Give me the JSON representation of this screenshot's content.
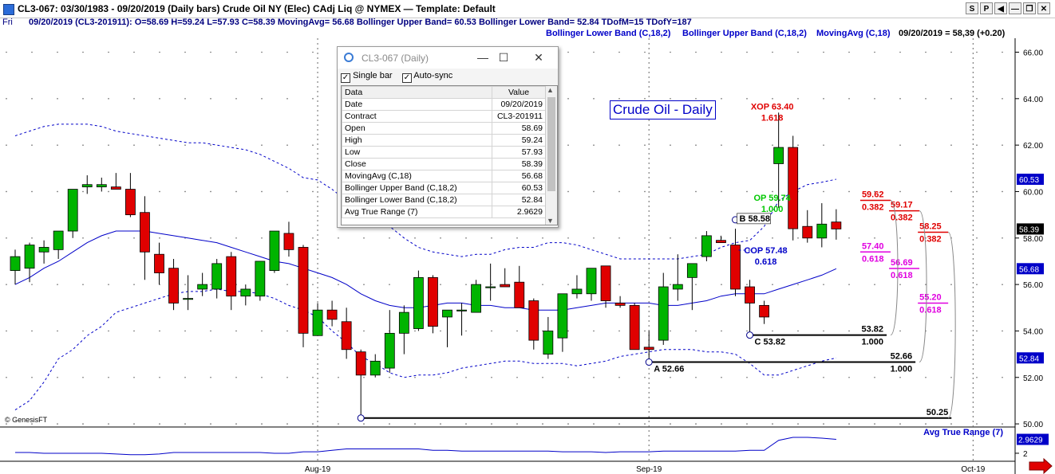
{
  "window": {
    "title": "CL3-067:  03/30/1983 - 09/20/2019  (Daily bars)   Crude Oil NY (Elec) CAdj Liq @ NYMEX  —  Template: Default",
    "buttons": [
      "S",
      "P",
      "◀",
      "—",
      "❐",
      "✕"
    ]
  },
  "infobar": {
    "day": "Fri",
    "text": "09/20/2019 (CL3-201911):  O=58.69  H=59.24  L=57.93  C=58.39  MovingAvg= 56.68  Bollinger Upper Band= 60.53  Bollinger Lower Band= 52.84  TDofM=15  TDofY=187"
  },
  "legend": {
    "lower": "Bollinger Lower Band (C,18,2)",
    "upper": "Bollinger Upper Band (C,18,2)",
    "ma": "MovingAvg (C,18)",
    "last": "09/20/2019 = 58,39 (+0.20)"
  },
  "colors": {
    "up": "#00b400",
    "down": "#e00000",
    "band": "#0000c8",
    "ma": "#0000c8",
    "pattern_red": "#e00000",
    "pattern_magenta": "#e000e0",
    "pattern_green": "#00c800",
    "ext_line": "#888888"
  },
  "popup": {
    "title": "CL3-067 (Daily)",
    "single_bar": "Single bar",
    "auto_sync": "Auto-sync",
    "col_data": "Data",
    "col_value": "Value",
    "rows": [
      {
        "k": "Date",
        "v": "09/20/2019"
      },
      {
        "k": "Contract",
        "v": "CL3-201911"
      },
      {
        "k": "Open",
        "v": "58.69"
      },
      {
        "k": "High",
        "v": "59.24"
      },
      {
        "k": "Low",
        "v": "57.93"
      },
      {
        "k": "Close",
        "v": "58.39"
      },
      {
        "k": "MovingAvg (C,18)",
        "v": "56.68"
      },
      {
        "k": "Bollinger Upper Band (C,18,2)",
        "v": "60.53"
      },
      {
        "k": "Bollinger Lower Band (C,18,2)",
        "v": "52.84"
      },
      {
        "k": "Avg True Range (7)",
        "v": "2.9629"
      }
    ]
  },
  "chart_title": "Crude Oil - Daily",
  "copyright": "© GenesisFT",
  "chart_data": {
    "type": "candlestick",
    "ylim": [
      49.9,
      66.6
    ],
    "y_ticks": [
      "50.00",
      "52.00",
      "54.00",
      "56.00",
      "58.00",
      "60.00",
      "62.00",
      "64.00",
      "66.00"
    ],
    "y_tick_values": [
      50,
      52,
      54,
      56,
      58,
      60,
      62,
      64,
      66
    ],
    "x_labels": [
      "Aug-19",
      "Sep-19",
      "Oct-19"
    ],
    "x_label_bar_index": [
      21,
      44,
      66.5
    ],
    "price_tags": [
      {
        "label": "60.53",
        "value": 60.53,
        "color": "#0000c8"
      },
      {
        "label": "58.39",
        "value": 58.39,
        "color": "#000000"
      },
      {
        "label": "56.68",
        "value": 56.68,
        "color": "#0000c8"
      },
      {
        "label": "52.84",
        "value": 52.84,
        "color": "#0000c8"
      }
    ],
    "candles": [
      {
        "o": 56.6,
        "h": 57.5,
        "l": 56.0,
        "c": 57.2
      },
      {
        "o": 56.7,
        "h": 57.8,
        "l": 56.1,
        "c": 57.7
      },
      {
        "o": 57.4,
        "h": 57.9,
        "l": 56.9,
        "c": 57.6
      },
      {
        "o": 57.5,
        "h": 58.2,
        "l": 57.1,
        "c": 58.3
      },
      {
        "o": 58.3,
        "h": 59.2,
        "l": 58.0,
        "c": 60.1
      },
      {
        "o": 60.2,
        "h": 60.7,
        "l": 59.9,
        "c": 60.3
      },
      {
        "o": 60.2,
        "h": 60.6,
        "l": 60.0,
        "c": 60.3
      },
      {
        "o": 60.2,
        "h": 60.8,
        "l": 60.1,
        "c": 60.1
      },
      {
        "o": 60.1,
        "h": 60.8,
        "l": 58.9,
        "c": 59.0
      },
      {
        "o": 59.1,
        "h": 59.8,
        "l": 56.2,
        "c": 57.4
      },
      {
        "o": 57.3,
        "h": 57.8,
        "l": 56.0,
        "c": 56.5
      },
      {
        "o": 56.7,
        "h": 57.1,
        "l": 54.9,
        "c": 55.2
      },
      {
        "o": 55.4,
        "h": 56.4,
        "l": 54.9,
        "c": 55.4
      },
      {
        "o": 55.8,
        "h": 56.5,
        "l": 55.5,
        "c": 56.0
      },
      {
        "o": 55.8,
        "h": 57.1,
        "l": 55.4,
        "c": 56.9
      },
      {
        "o": 57.2,
        "h": 57.4,
        "l": 54.9,
        "c": 55.5
      },
      {
        "o": 55.5,
        "h": 56.0,
        "l": 55.1,
        "c": 55.8
      },
      {
        "o": 55.5,
        "h": 57.0,
        "l": 55.3,
        "c": 57.0
      },
      {
        "o": 56.6,
        "h": 58.3,
        "l": 56.5,
        "c": 58.3
      },
      {
        "o": 58.2,
        "h": 58.7,
        "l": 57.2,
        "c": 57.5
      },
      {
        "o": 57.6,
        "h": 57.7,
        "l": 53.3,
        "c": 53.9
      },
      {
        "o": 53.8,
        "h": 55.2,
        "l": 53.8,
        "c": 54.9
      },
      {
        "o": 54.9,
        "h": 55.3,
        "l": 54.2,
        "c": 54.5
      },
      {
        "o": 54.4,
        "h": 55.0,
        "l": 52.8,
        "c": 53.2
      },
      {
        "o": 53.1,
        "h": 53.2,
        "l": 50.2,
        "c": 52.1
      },
      {
        "o": 52.1,
        "h": 53.0,
        "l": 52.0,
        "c": 52.7
      },
      {
        "o": 52.4,
        "h": 54.9,
        "l": 52.2,
        "c": 53.9
      },
      {
        "o": 53.9,
        "h": 55.1,
        "l": 53.0,
        "c": 54.8
      },
      {
        "o": 54.1,
        "h": 56.6,
        "l": 54.0,
        "c": 56.3
      },
      {
        "o": 56.3,
        "h": 56.4,
        "l": 53.9,
        "c": 54.2
      },
      {
        "o": 54.6,
        "h": 54.9,
        "l": 53.3,
        "c": 54.9
      },
      {
        "o": 54.9,
        "h": 55.2,
        "l": 53.8,
        "c": 54.9
      },
      {
        "o": 54.8,
        "h": 56.2,
        "l": 54.8,
        "c": 56.0
      },
      {
        "o": 55.9,
        "h": 56.9,
        "l": 55.3,
        "c": 55.9
      },
      {
        "o": 56.0,
        "h": 56.7,
        "l": 55.9,
        "c": 55.9
      },
      {
        "o": 56.1,
        "h": 56.8,
        "l": 55.0,
        "c": 55.0
      },
      {
        "o": 55.3,
        "h": 55.4,
        "l": 53.2,
        "c": 53.6
      },
      {
        "o": 53.0,
        "h": 54.6,
        "l": 52.8,
        "c": 54.0
      },
      {
        "o": 53.7,
        "h": 55.5,
        "l": 53.1,
        "c": 55.6
      },
      {
        "o": 55.6,
        "h": 56.4,
        "l": 55.4,
        "c": 55.8
      },
      {
        "o": 55.6,
        "h": 56.7,
        "l": 55.3,
        "c": 56.7
      },
      {
        "o": 56.8,
        "h": 56.8,
        "l": 55.0,
        "c": 55.3
      },
      {
        "o": 55.2,
        "h": 55.5,
        "l": 55.0,
        "c": 55.1
      },
      {
        "o": 55.1,
        "h": 55.2,
        "l": 53.4,
        "c": 53.2
      },
      {
        "o": 53.3,
        "h": 54.0,
        "l": 52.66,
        "c": 53.2
      },
      {
        "o": 53.6,
        "h": 56.5,
        "l": 53.4,
        "c": 55.9
      },
      {
        "o": 55.8,
        "h": 57.3,
        "l": 55.3,
        "c": 56.0
      },
      {
        "o": 56.3,
        "h": 56.9,
        "l": 54.9,
        "c": 56.9
      },
      {
        "o": 57.2,
        "h": 58.3,
        "l": 57.0,
        "c": 58.1
      },
      {
        "o": 57.9,
        "h": 58.1,
        "l": 57.9,
        "c": 57.8
      },
      {
        "o": 57.7,
        "h": 58.4,
        "l": 55.5,
        "c": 55.8
      },
      {
        "o": 55.9,
        "h": 56.2,
        "l": 53.82,
        "c": 55.2
      },
      {
        "o": 55.1,
        "h": 55.3,
        "l": 54.3,
        "c": 54.6
      },
      {
        "o": 61.2,
        "h": 63.4,
        "l": 59.3,
        "c": 61.9
      },
      {
        "o": 61.9,
        "h": 62.4,
        "l": 57.9,
        "c": 58.4
      },
      {
        "o": 58.5,
        "h": 59.2,
        "l": 57.8,
        "c": 58.0
      },
      {
        "o": 58.0,
        "h": 59.5,
        "l": 57.6,
        "c": 58.6
      },
      {
        "o": 58.69,
        "h": 59.24,
        "l": 57.93,
        "c": 58.39
      }
    ],
    "moving_avg": [
      56.0,
      56.3,
      56.7,
      57.0,
      57.4,
      57.8,
      58.1,
      58.3,
      58.3,
      58.3,
      58.2,
      58.1,
      58.0,
      57.9,
      57.8,
      57.6,
      57.4,
      57.2,
      57.0,
      56.9,
      56.7,
      56.5,
      56.3,
      56.0,
      55.6,
      55.3,
      55.1,
      55.0,
      55.0,
      55.1,
      55.2,
      55.2,
      55.1,
      55.1,
      55.0,
      55.0,
      54.9,
      54.9,
      54.9,
      55.0,
      55.1,
      55.2,
      55.2,
      55.2,
      55.2,
      55.1,
      55.1,
      55.2,
      55.3,
      55.5,
      55.6,
      55.6,
      55.6,
      55.8,
      56.0,
      56.2,
      56.4,
      56.68
    ],
    "bb_upper": [
      62.4,
      62.6,
      62.8,
      62.9,
      62.9,
      62.9,
      62.8,
      62.6,
      62.5,
      62.4,
      62.3,
      62.2,
      62.1,
      62.1,
      62.0,
      61.9,
      61.8,
      61.6,
      61.3,
      61.0,
      60.6,
      60.5,
      60.1,
      59.6,
      59.2,
      59.0,
      58.5,
      58.0,
      57.6,
      57.4,
      57.3,
      57.2,
      57.3,
      57.3,
      57.5,
      57.6,
      57.6,
      57.8,
      57.8,
      57.7,
      57.5,
      57.3,
      57.1,
      57.1,
      57.1,
      57.1,
      57.1,
      57.2,
      57.3,
      57.6,
      57.8,
      57.9,
      58.5,
      59.6,
      60.0,
      60.3,
      60.4,
      60.53
    ],
    "bb_lower": [
      50.6,
      51.0,
      51.8,
      52.8,
      53.2,
      53.8,
      54.2,
      54.8,
      55.0,
      55.2,
      55.4,
      55.6,
      55.7,
      55.7,
      55.8,
      55.7,
      55.7,
      55.6,
      55.4,
      55.1,
      54.9,
      54.6,
      54.0,
      53.5,
      52.9,
      52.6,
      52.2,
      52.0,
      52.1,
      52.1,
      52.2,
      52.4,
      52.5,
      52.6,
      52.7,
      52.7,
      52.6,
      52.6,
      52.6,
      52.5,
      52.6,
      52.7,
      52.9,
      53.0,
      53.1,
      53.2,
      53.2,
      53.2,
      53.1,
      53.1,
      53.0,
      52.6,
      52.1,
      52.1,
      52.3,
      52.5,
      52.7,
      52.84
    ],
    "atr": [
      2.05,
      2.05,
      2.0,
      2.0,
      2.0,
      2.0,
      2.0,
      1.95,
      1.9,
      1.9,
      1.95,
      2.05,
      2.05,
      2.05,
      2.05,
      2.05,
      2.05,
      2.05,
      2.0,
      2.0,
      2.1,
      2.1,
      2.2,
      2.3,
      2.3,
      2.3,
      2.3,
      2.3,
      2.3,
      2.2,
      2.2,
      2.15,
      2.15,
      2.15,
      2.15,
      2.15,
      2.15,
      2.15,
      2.1,
      2.1,
      2.1,
      2.05,
      2.1,
      2.1,
      2.1,
      2.15,
      2.15,
      2.15,
      2.15,
      2.15,
      2.15,
      2.2,
      2.2,
      2.9,
      3.1,
      3.1,
      3.05,
      2.9629
    ],
    "atr_label": "Avg True Range (7)",
    "atr_value": "2.9629",
    "atr_ticks": [
      "2"
    ],
    "atr_tick_values": [
      2
    ],
    "atr_ylim": [
      1.5,
      3.6
    ],
    "pattern": {
      "X": {
        "label": "XOP 63.40",
        "ratio": "1.618",
        "bar": 53,
        "price": 63.4
      },
      "B": {
        "label": "B 58.58",
        "bar": 50,
        "price": 58.58
      },
      "A": {
        "label": "A 52.66",
        "bar": 44,
        "price": 52.66
      },
      "C": {
        "label": "C 53.82",
        "bar": 51,
        "price": 53.82
      },
      "OP": {
        "label": "OP 59.74",
        "ratio": "1.000",
        "bar": 53,
        "price": 59.74
      },
      "COP": {
        "label": "COP 57.48",
        "ratio": "0.618",
        "bar": 51,
        "price": 57.48
      }
    },
    "low_label": {
      "bar": 24,
      "price": 50.25
    },
    "horizontal_levels": [
      {
        "price": 53.82,
        "label": "53.82",
        "sub": "1.000",
        "x_start_bar": 51,
        "x_end_bar": 60.5
      },
      {
        "price": 52.66,
        "label": "52.66",
        "sub": "1.000",
        "x_start_bar": 44,
        "x_end_bar": 62.5
      },
      {
        "price": 50.25,
        "label": "50.25",
        "sub": "",
        "x_start_bar": 24,
        "x_end_bar": 65
      }
    ],
    "projection_levels": [
      {
        "price": 59.62,
        "label": "59.62",
        "sub": "0.382",
        "color": "#e00000",
        "x_bar": 59
      },
      {
        "price": 59.17,
        "label": "59.17",
        "sub": "0.382",
        "color": "#e00000",
        "x_bar": 61
      },
      {
        "price": 58.25,
        "label": "58.25",
        "sub": "0.382",
        "color": "#e00000",
        "x_bar": 63
      },
      {
        "price": 57.4,
        "label": "57.40",
        "sub": "0.618",
        "color": "#e000e0",
        "x_bar": 59
      },
      {
        "price": 56.69,
        "label": "56.69",
        "sub": "0.618",
        "color": "#e000e0",
        "x_bar": 61
      },
      {
        "price": 55.2,
        "label": "55.20",
        "sub": "0.618",
        "color": "#e000e0",
        "x_bar": 63
      }
    ]
  }
}
